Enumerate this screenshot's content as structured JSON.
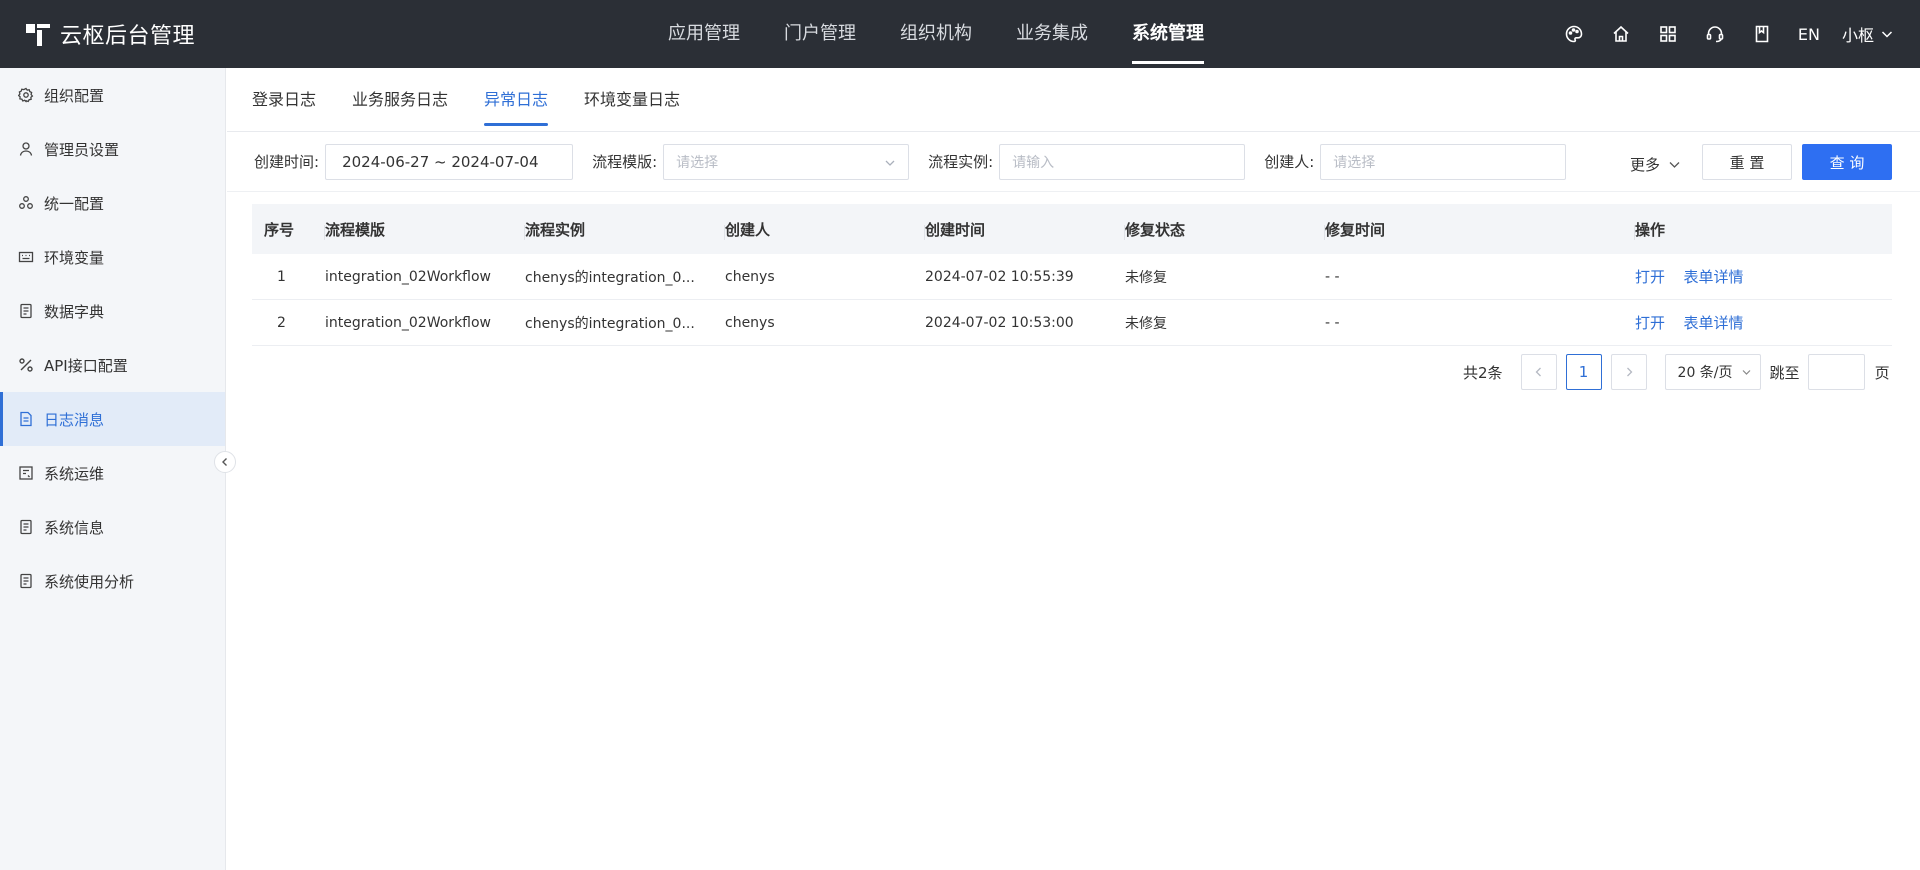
{
  "header": {
    "brand": "云枢后台管理",
    "nav": [
      {
        "label": "应用管理",
        "active": false
      },
      {
        "label": "门户管理",
        "active": false
      },
      {
        "label": "组织机构",
        "active": false
      },
      {
        "label": "业务集成",
        "active": false
      },
      {
        "label": "系统管理",
        "active": true
      }
    ],
    "tools": [
      "palette-icon",
      "home-icon",
      "apps-grid-icon",
      "headset-icon",
      "book-icon"
    ],
    "lang": "EN",
    "user": "小枢"
  },
  "sidebar": {
    "items": [
      {
        "label": "组织配置",
        "icon": "gear-icon",
        "active": false
      },
      {
        "label": "管理员设置",
        "icon": "user-icon",
        "active": false
      },
      {
        "label": "统一配置",
        "icon": "cluster-icon",
        "active": false
      },
      {
        "label": "环境变量",
        "icon": "keyboard-icon",
        "active": false
      },
      {
        "label": "数据字典",
        "icon": "document-icon",
        "active": false
      },
      {
        "label": "API接口配置",
        "icon": "api-icon",
        "active": false
      },
      {
        "label": "日志消息",
        "icon": "log-icon",
        "active": true
      },
      {
        "label": "系统运维",
        "icon": "ops-icon",
        "active": false
      },
      {
        "label": "系统信息",
        "icon": "info-doc-icon",
        "active": false
      },
      {
        "label": "系统使用分析",
        "icon": "analysis-doc-icon",
        "active": false
      }
    ]
  },
  "tabs": [
    {
      "label": "登录日志",
      "active": false
    },
    {
      "label": "业务服务日志",
      "active": false
    },
    {
      "label": "异常日志",
      "active": true
    },
    {
      "label": "环境变量日志",
      "active": false
    }
  ],
  "filters": {
    "created_time_label": "创建时间:",
    "created_time_value": "2024-06-27 ~ 2024-07-04",
    "template_label": "流程模版:",
    "template_placeholder": "请选择",
    "instance_label": "流程实例:",
    "instance_placeholder": "请输入",
    "creator_label": "创建人:",
    "creator_placeholder": "请选择",
    "more_label": "更多",
    "reset_label": "重 置",
    "query_label": "查 询"
  },
  "table": {
    "columns": [
      "序号",
      "流程模版",
      "流程实例",
      "创建人",
      "创建时间",
      "修复状态",
      "修复时间",
      "操作"
    ],
    "rows": [
      {
        "index": "1",
        "template": "integration_02Workflow",
        "instance": "chenys的integration_0...",
        "creator": "chenys",
        "created": "2024-07-02 10:55:39",
        "status": "未修复",
        "fixed_time": "- -",
        "action_open": "打开",
        "action_detail": "表单详情"
      },
      {
        "index": "2",
        "template": "integration_02Workflow",
        "instance": "chenys的integration_0...",
        "creator": "chenys",
        "created": "2024-07-02 10:53:00",
        "status": "未修复",
        "fixed_time": "- -",
        "action_open": "打开",
        "action_detail": "表单详情"
      }
    ]
  },
  "pagination": {
    "total": "共2条",
    "current_page": "1",
    "page_size": "20 条/页",
    "jump_label": "跳至",
    "page_unit": "页"
  },
  "colors": {
    "header_bg": "#2b2f36",
    "accent": "#2f6fd6",
    "primary_button": "#2e6ff2",
    "sidebar_bg": "#f4f6f9",
    "sidebar_active_bg": "#e2ebf8"
  }
}
